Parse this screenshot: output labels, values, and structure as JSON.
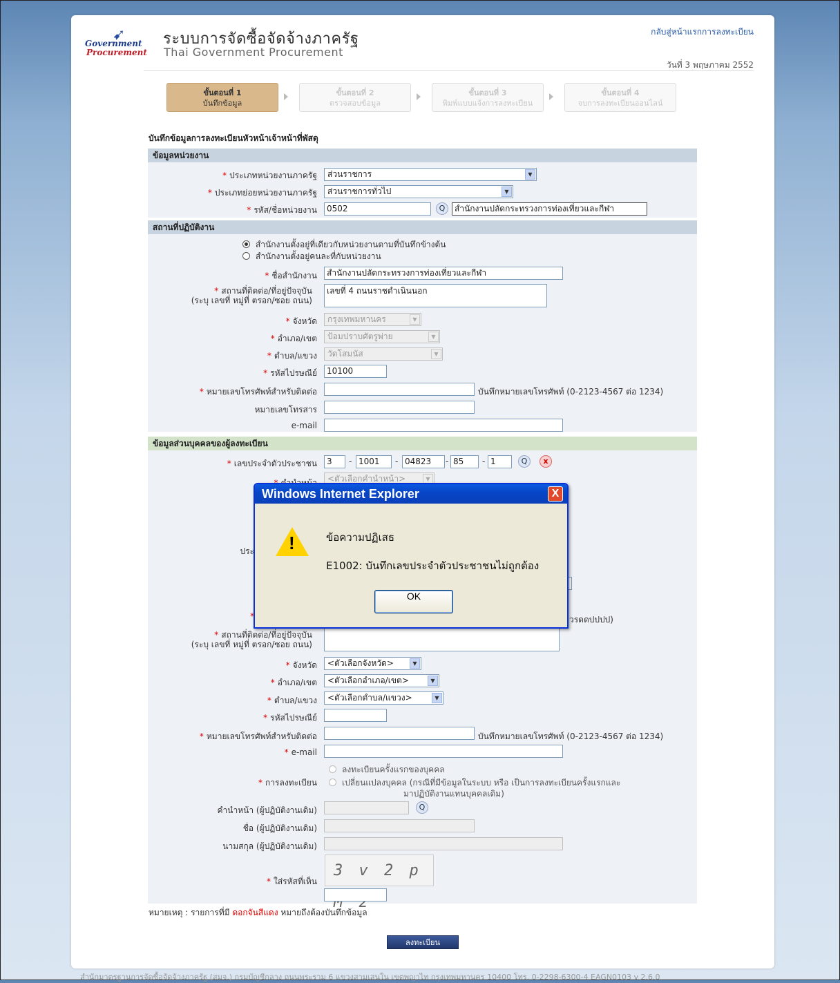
{
  "header": {
    "logo_line1": "Government",
    "logo_line2": "Procurement",
    "title_th": "ระบบการจัดซื้อจัดจ้างภาครัฐ",
    "title_en": "Thai Government Procurement",
    "back_link": "กลับสู่หน้าแรกการลงทะเบียน",
    "date": "วันที่ 3 พฤษภาคม 2552"
  },
  "steps": [
    {
      "num": "ขั้นตอนที่ 1",
      "label": "บันทึกข้อมูล"
    },
    {
      "num": "ขั้นตอนที่ 2",
      "label": "ตรวจสอบข้อมูล"
    },
    {
      "num": "ขั้นตอนที่ 3",
      "label": "พิมพ์แบบแจ้งการลงทะเบียน"
    },
    {
      "num": "ขั้นตอนที่ 4",
      "label": "จบการลงทะเบียนออนไลน์"
    }
  ],
  "page_heading": "บันทึกข้อมูลการลงทะเบียนหัวหน้าเจ้าหน้าที่พัสดุ",
  "agency": {
    "section": "ข้อมูลหน่วยงาน",
    "type_label": "ประเภทหน่วยงานภาครัฐ",
    "type_value": "ส่วนราชการ",
    "subtype_label": "ประเภทย่อยหน่วยงานภาครัฐ",
    "subtype_value": "ส่วนราชการทั่วไป",
    "code_label": "รหัส/ชื่อหน่วยงาน",
    "code_value": "0502",
    "name_value": "สำนักงานปลัดกระทรวงการท่องเที่ยวและกีฬา"
  },
  "workplace": {
    "section": "สถานที่ปฏิบัติงาน",
    "radio1": "สำนักงานตั้งอยู่ที่เดียวกับหน่วยงานตามที่บันทึกข้างต้น",
    "radio2": "สำนักงานตั้งอยู่คนละที่กับหน่วยงาน",
    "office_label": "ชื่อสำนักงาน",
    "office_value": "สำนักงานปลัดกระทรวงการท่องเที่ยวและกีฬา",
    "address_label1": "สถานที่ติดต่อ/ที่อยู่ปัจจุบัน",
    "address_label2": "(ระบุ เลขที่ หมู่ที่ ตรอก/ซอย ถนน)",
    "address_value": "เลขที่ 4  ถนนราชดำเนินนอก",
    "province_label": "จังหวัด",
    "province_value": "กรุงเทพมหานคร",
    "district_label": "อำเภอ/เขต",
    "district_value": "ป้อมปราบศัตรูพ่าย",
    "subdistrict_label": "ตำบล/แขวง",
    "subdistrict_value": "วัดโสมนัส",
    "postcode_label": "รหัสไปรษณีย์",
    "postcode_value": "10100",
    "phone_label": "หมายเลขโทรศัพท์สำหรับติดต่อ",
    "phone_hint": "บันทึกหมายเลขโทรศัพท์ (0-2123-4567 ต่อ 1234)",
    "fax_label": "หมายเลขโทรสาร",
    "email_label": "e-mail"
  },
  "personal": {
    "section": "ข้อมูลส่วนบุคคลของผู้ลงทะเบียน",
    "id_label": "เลขประจำตัวประชาชน",
    "id_parts": [
      "3",
      "1001",
      "04823",
      "85",
      "1"
    ],
    "prefix_label": "คำนำหน้า",
    "prefix_value": "<ตัวเลือกคำนำหน้า>",
    "partial_label": "ประ",
    "partial_hint": "วรดดปปปป)",
    "address_label1": "สถานที่ติดต่อ/ที่อยู่ปัจจุบัน",
    "address_label2": "(ระบุ เลขที่ หมู่ที่ ตรอก/ซอย ถนน)",
    "province_label": "จังหวัด",
    "province_value": "<ตัวเลือกจังหวัด>",
    "district_label": "อำเภอ/เขต",
    "district_value": "<ตัวเลือกอำเภอ/เขต>",
    "subdistrict_label": "ตำบล/แขวง",
    "subdistrict_value": "<ตัวเลือกตำบล/แขวง>",
    "postcode_label": "รหัสไปรษณีย์",
    "phone_label": "หมายเลขโทรศัพท์สำหรับติดต่อ",
    "phone_hint": "บันทึกหมายเลขโทรศัพท์ (0-2123-4567 ต่อ 1234)",
    "email_label": "e-mail",
    "reg_label": "การลงทะเบียน",
    "reg_opt1": "ลงทะเบียนครั้งแรกของบุคคล",
    "reg_opt2_line1": "เปลี่ยนแปลงบุคคล (กรณีที่มีข้อมูลในระบบ หรือ เป็นการลงทะเบียนครั้งแรกและ",
    "reg_opt2_line2": "มาปฏิบัติงานแทนบุคคลเดิม)",
    "old_prefix_label": "คำนำหน้า (ผู้ปฏิบัติงานเดิม)",
    "old_name_label": "ชื่อ (ผู้ปฏิบัติงานเดิม)",
    "old_surname_label": "นามสกุล (ผู้ปฏิบัติงานเดิม)",
    "captcha_label": "ใส่รหัสที่เห็น",
    "captcha_text": "3 v 2 p M 2"
  },
  "note": {
    "prefix": "หมายเหตุ : รายการที่มี ",
    "red": "ดอกจันสีแดง",
    "suffix": " หมายถึงต้องบันทึกข้อมูล"
  },
  "submit_label": "ลงทะเบียน",
  "footer": "สำนักมาตรฐานการจัดซื้อจัดจ้างภาครัฐ (สมจ.) กรมบัญชีกลาง ถนนพระราม 6 แขวงสามเสนใน เขตพญาไท กรุงเทพมหานคร 10400 โทร. 0-2298-6300-4     EAGN0103 v 2.6.0",
  "dialog": {
    "title": "Windows Internet Explorer",
    "close": "X",
    "message_title": "ข้อความปฏิเสธ",
    "message": "E1002: บันทึกเลขประจำตัวประชาชนไม่ถูกต้อง",
    "ok": "OK"
  },
  "star": "*",
  "dropdown_glyph": "▼",
  "search_glyph": "Q",
  "clear_glyph": "x",
  "dash": "-",
  "colors": {
    "accent": "#0a4fd8",
    "required": "#dd0000",
    "step_active": "#d9b98c"
  }
}
